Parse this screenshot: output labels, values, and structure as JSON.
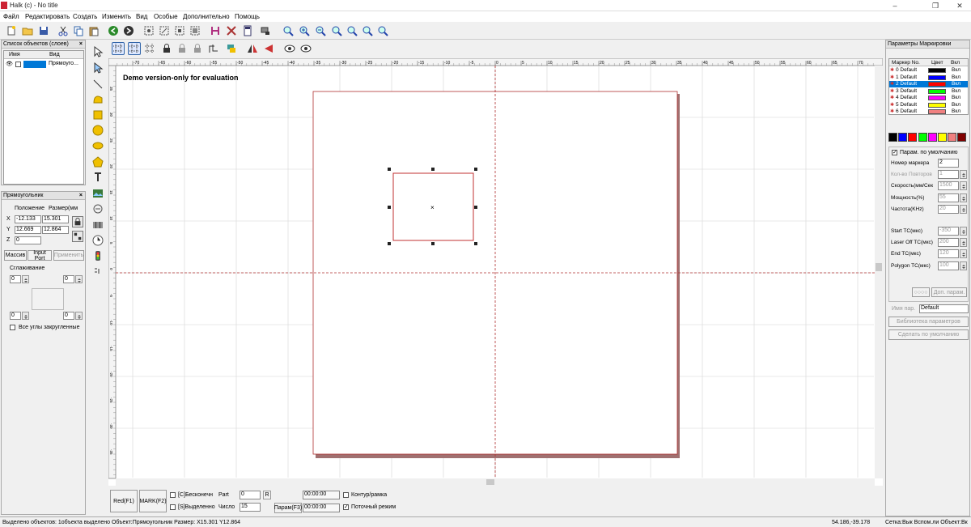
{
  "window": {
    "title": "Halk (c) - No title"
  },
  "menu": [
    "Файл",
    "Редактировать",
    "Создать",
    "Изменить",
    "Вид",
    "Особые",
    "Дополнительно",
    "Помощь"
  ],
  "objects_panel": {
    "title": "Список объектов (слоев)",
    "col_name": "Имя",
    "col_view": "Вид",
    "row_view": "Прямоуго..."
  },
  "prop_panel": {
    "title": "Прямоугольник",
    "pos_header": "Положение",
    "size_header": "Размер(мм",
    "x_label": "X",
    "y_label": "Y",
    "z_label": "Z",
    "x_pos": "-12.133",
    "x_size": "15.301",
    "y_pos": "12.669",
    "y_size": "12.864",
    "z_pos": "0",
    "tab_array": "Массив",
    "tab_input": "Input Port",
    "apply": "Применить",
    "smoothing": "Сглаживание",
    "c1": "0",
    "c2": "0",
    "c3": "0",
    "c4": "0",
    "all_round": "Все углы закругленные"
  },
  "canvas": {
    "demo_text": "Demo version-only for evaluation",
    "ruler_labels": [
      "-70",
      "-65",
      "-60",
      "-55",
      "-50",
      "-45",
      "-40",
      "-35",
      "-30",
      "-25",
      "-20",
      "-15",
      "-10",
      "-5",
      "0",
      "5",
      "10",
      "15",
      "20",
      "25",
      "30",
      "35",
      "40",
      "45",
      "50",
      "55",
      "60",
      "65",
      "70"
    ],
    "vruler_labels": [
      "35",
      "30",
      "25",
      "20",
      "15",
      "10",
      "5",
      "0",
      "-5",
      "-10",
      "-15",
      "-20",
      "-25",
      "-30",
      "-35"
    ]
  },
  "bottom": {
    "red": "Red(F1)",
    "mark": "MARK(F2)",
    "endless": "[C]Бесконечн",
    "selected": "[S]Выделенно",
    "part": "Part",
    "part_value": "0",
    "r": "R",
    "count": "Число",
    "count_value": "15",
    "time1": "00:00:00",
    "time2": "00:00:00",
    "param": "Парам(F3)",
    "contour": "Контур/рамка",
    "stream": "Поточный режим"
  },
  "right_panel": {
    "title": "Параметры Маркировки",
    "col_marker": "Маркер No.",
    "col_color": "Цвет",
    "col_on": "Вкл",
    "markers": [
      {
        "label": "0 Default",
        "color": "#000000",
        "on": "Вкл"
      },
      {
        "label": "1 Default",
        "color": "#0000ff",
        "on": "Вкл"
      },
      {
        "label": "2 Default",
        "color": "#ff0000",
        "on": "Вкл"
      },
      {
        "label": "3 Default",
        "color": "#00ff00",
        "on": "Вкл"
      },
      {
        "label": "4 Default",
        "color": "#ff00ff",
        "on": "Вкл"
      },
      {
        "label": "5 Default",
        "color": "#ffff00",
        "on": "Вкл"
      },
      {
        "label": "6 Default",
        "color": "#f08080",
        "on": "Вкл"
      }
    ],
    "palette": [
      "#000000",
      "#0000ff",
      "#ff0000",
      "#00ff00",
      "#ff00ff",
      "#ffff00",
      "#f08080",
      "#800000"
    ],
    "default_params": "Парам. по умолчанию",
    "fields": [
      {
        "label": "Номер маркера",
        "value": "2"
      },
      {
        "label": "Кол-во Повторов",
        "value": "1"
      },
      {
        "label": "Скорость(мм/Сек",
        "value": "1500"
      },
      {
        "label": "Мощность(%)",
        "value": "55"
      },
      {
        "label": "Частота(KHz)",
        "value": "20"
      }
    ],
    "fields2": [
      {
        "label": "Start TC(мкс)",
        "value": "-350"
      },
      {
        "label": "Laser Off TC(мкс)",
        "value": "200"
      },
      {
        "label": "End TC(мкс)",
        "value": "120"
      },
      {
        "label": "Polygon TC(мкс)",
        "value": "100"
      }
    ],
    "extra": "Доп. парам.",
    "param_name_label": "Имя пар.",
    "param_name_value": "Default",
    "library": "Библиотека параметров",
    "make_default": "Сделать по умолчанию"
  },
  "status": {
    "left": "Выделено объектов: 1объекта выделено Объект:Прямоугольник Размер: X15.301 Y12.864",
    "coords": "54.186,-39.178",
    "right": "Сетка:Вык Вспом.ли Объект:Вк"
  }
}
